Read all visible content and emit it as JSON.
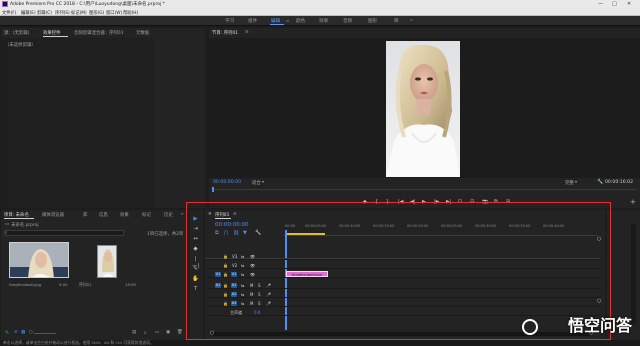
{
  "title_bar": {
    "text": "Adobe Premiere Pro CC 2018 - C:\\用户\\Luoyudong\\桌面\\未命名.prproj *",
    "minimize": "—",
    "maximize": "□",
    "close": "✕"
  },
  "menu": [
    "文件(F)",
    "编辑(E)",
    "剪辑(C)",
    "序列(S)",
    "标记(M)",
    "图形(G)",
    "窗口(W)",
    "帮助(H)"
  ],
  "workspaces": {
    "items": [
      "学习",
      "组件",
      "编辑",
      "颜色",
      "效果",
      "音频",
      "图形",
      "库"
    ],
    "active": "编辑",
    "more": "»"
  },
  "source_panel": {
    "tabs": [
      "源：(无剪辑)",
      "效果控件",
      "音频剪辑混合器：序列01",
      "元数据"
    ],
    "active_tab": "效果控件",
    "empty_text": "（未选择剪辑）"
  },
  "program_monitor": {
    "tab": "节目: 序列01",
    "timecode_left": "00:00:00:00",
    "fit": "适合",
    "quality": "完整",
    "timecode_right": "00:00:16:02",
    "transport": [
      "◆",
      "{",
      "}",
      "|◀",
      "◀|",
      "▶",
      "|▶",
      "▶|",
      "⊡",
      "⊟",
      "📷",
      "⧉",
      "⊞"
    ],
    "add": "+"
  },
  "project_panel": {
    "tabs": [
      "项目: 未命名",
      "媒体浏览器",
      "库",
      "信息",
      "效果",
      "标记",
      "历史"
    ],
    "active_tab": "项目: 未命名",
    "more": "»",
    "project_file": "未命名.prproj",
    "item_count": "1项已选择，共2项",
    "items": [
      {
        "name": "timg9nniwcfy.jpg",
        "duration": "5:00"
      },
      {
        "name": "序列01",
        "duration": "13:00"
      }
    ],
    "bottom_icons": [
      "list",
      "icon",
      "freeform",
      "slider",
      "sort",
      "find",
      "bin",
      "new",
      "delete"
    ]
  },
  "tools": [
    "▶",
    "⇥",
    "↔",
    "◆",
    "|—|",
    "✎",
    "✋",
    "T"
  ],
  "timeline": {
    "tab": "序列01",
    "timecode": "00:00:00:00",
    "ruler": [
      "00:00",
      "00:00:05:00",
      "00:00:10:00",
      "00:00:15:00",
      "00:00:20:00",
      "00:00:25:00",
      "00:00:30:00",
      "00:00:35:00",
      "00:00:40:00"
    ],
    "video_tracks": [
      {
        "target": "V3",
        "label": "V3"
      },
      {
        "target": "V2",
        "label": "V2"
      },
      {
        "target": "V1",
        "label": "V1"
      }
    ],
    "audio_tracks": [
      {
        "target": "A1",
        "label": "A1"
      },
      {
        "target": "A2",
        "label": "A2"
      },
      {
        "target": "A3",
        "label": "A3"
      }
    ],
    "track_buttons": {
      "lock": "🔒",
      "sync": "⇆",
      "mute": "M",
      "solo": "S",
      "eye": "👁",
      "mic": "🎤"
    },
    "master": {
      "label": "主声道",
      "value": "0.0"
    },
    "clip": {
      "label": "timg9nniwcfy.jpg"
    }
  },
  "status_bar": {
    "text": "单击以选择，或单击空白处并拖动以进行框选。使用 Shift、Alt 和 Ctrl 可获得其他选项。"
  },
  "watermark": {
    "text": "悟空问答"
  },
  "colors": {
    "accent_blue": "#5a9cf8",
    "clip_pink": "#e06ed4",
    "highlight_red": "#e53030"
  }
}
